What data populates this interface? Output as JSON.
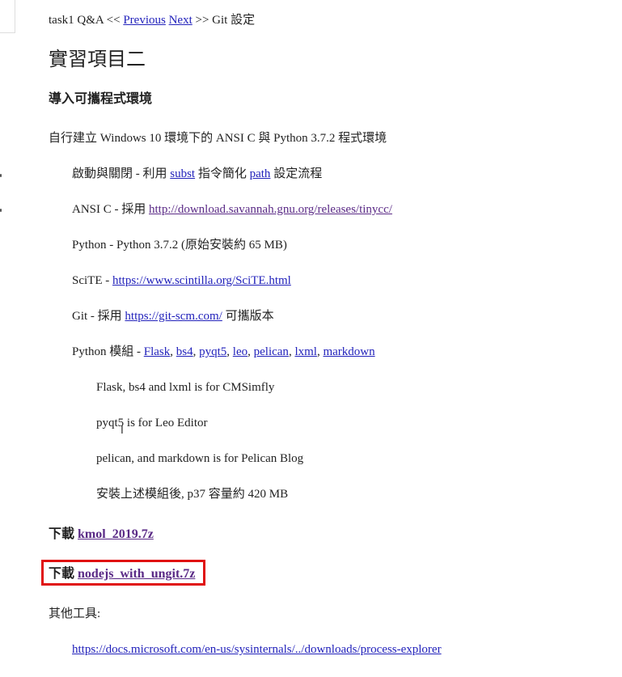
{
  "nav": {
    "prefix": "task1 Q&A <<",
    "previous": "Previous",
    "next": "Next",
    "suffix": ">> Git 設定"
  },
  "page_title": "實習項目二",
  "section_heading": "導入可攜程式環境",
  "intro": "自行建立 Windows 10 環境下的 ANSI C 與 Python 3.7.2 程式環境",
  "items": {
    "startup": {
      "before": "啟動與關閉  - 利用",
      "link1": "subst",
      "middle": "指令簡化",
      "link2": "path",
      "after": "設定流程"
    },
    "ansic": {
      "before": "ANSI C - 採用",
      "link": "http://download.savannah.gnu.org/releases/tinycc/"
    },
    "python": {
      "text": "Python - Python 3.7.2 (原始安裝約 65 MB)"
    },
    "scite": {
      "before": "SciTE -",
      "link": "https://www.scintilla.org/SciTE.html"
    },
    "git": {
      "before": "Git - 採用",
      "link": "https://git-scm.com/",
      "after": "可攜版本"
    },
    "modules": {
      "before": "Python 模組 -",
      "links": [
        "Flask",
        "bs4",
        "pyqt5",
        "leo",
        "pelican",
        "lxml",
        "markdown"
      ]
    }
  },
  "notes": {
    "flask": "Flask, bs4 and lxml is for CMSimfly",
    "pyqt": "pyqt5 is for Leo Editor",
    "pelican": "pelican, and markdown is for Pelican Blog",
    "size": "安裝上述模組後, p37 容量約 420 MB"
  },
  "downloads": {
    "kmol": {
      "label": "下載",
      "link": "kmol_2019.7z"
    },
    "nodejs": {
      "label": "下載",
      "link": "nodejs_with_ungit.7z"
    }
  },
  "other_tools": {
    "label": "其他工具:",
    "link": "https://docs.microsoft.com/en-us/sysinternals/../downloads/process-explorer"
  },
  "colors": {
    "link": "#2222bb",
    "visited_link": "#5a2a86",
    "highlight_border": "#e01010"
  }
}
